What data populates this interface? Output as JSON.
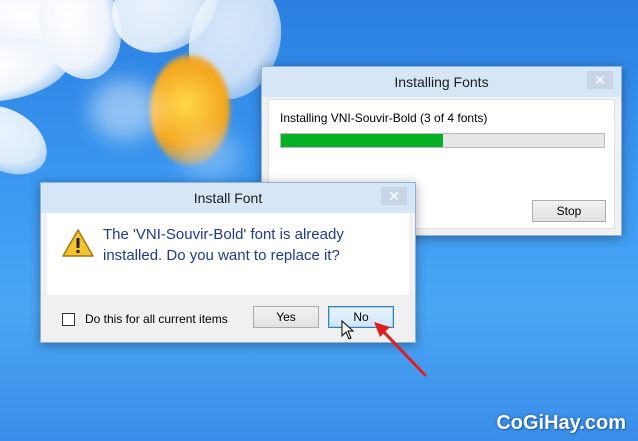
{
  "progress_window": {
    "title": "Installing Fonts",
    "status": "Installing VNI-Souvir-Bold (3 of 4 fonts)",
    "progress_fraction": 0.5,
    "stop_label": "Stop",
    "close_label": "✕"
  },
  "install_dialog": {
    "title": "Install Font",
    "message_line1": "The 'VNI-Souvir-Bold' font is already",
    "message_line2": "installed. Do you want to replace it?",
    "checkbox_label": "Do this for all current items",
    "checkbox_checked": false,
    "yes_label": "Yes",
    "no_label": "No",
    "close_label": "✕",
    "icon": "warning-icon"
  },
  "watermark": "CoGiHay.com",
  "colors": {
    "progress_fill": "#06b025",
    "message_text": "#1f3b8f",
    "titlebar": "#d6e6f7",
    "annotation_arrow": "#e02020"
  }
}
